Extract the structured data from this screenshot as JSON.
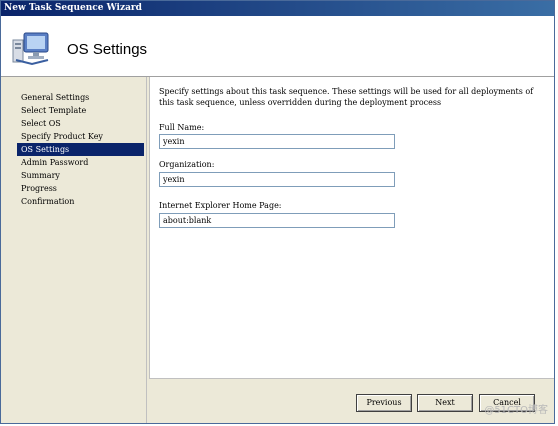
{
  "window": {
    "title": "New Task Sequence Wizard"
  },
  "header": {
    "title": "OS Settings",
    "icon": "computer-monitor-icon"
  },
  "nav": {
    "items": [
      {
        "label": "General Settings",
        "active": false
      },
      {
        "label": "Select Template",
        "active": false
      },
      {
        "label": "Select OS",
        "active": false
      },
      {
        "label": "Specify Product Key",
        "active": false
      },
      {
        "label": "OS Settings",
        "active": true
      },
      {
        "label": "Admin Password",
        "active": false
      },
      {
        "label": "Summary",
        "active": false
      },
      {
        "label": "Progress",
        "active": false
      },
      {
        "label": "Confirmation",
        "active": false
      }
    ]
  },
  "main": {
    "description": "Specify settings about this task sequence.  These settings will be used for all deployments of this task sequence, unless overridden during the deployment process",
    "full_name": {
      "label": "Full Name:",
      "value": "yexin"
    },
    "organization": {
      "label": "Organization:",
      "value": "yexin"
    },
    "ie_home_page": {
      "label": "Internet Explorer Home Page:",
      "value": "about:blank"
    }
  },
  "buttons": {
    "previous": "Previous",
    "next": "Next",
    "cancel": "Cancel"
  },
  "watermark": "@51CTO博客",
  "colors": {
    "titlebar": "#0a246a",
    "selection": "#0a246a",
    "background": "#ece9d8"
  }
}
